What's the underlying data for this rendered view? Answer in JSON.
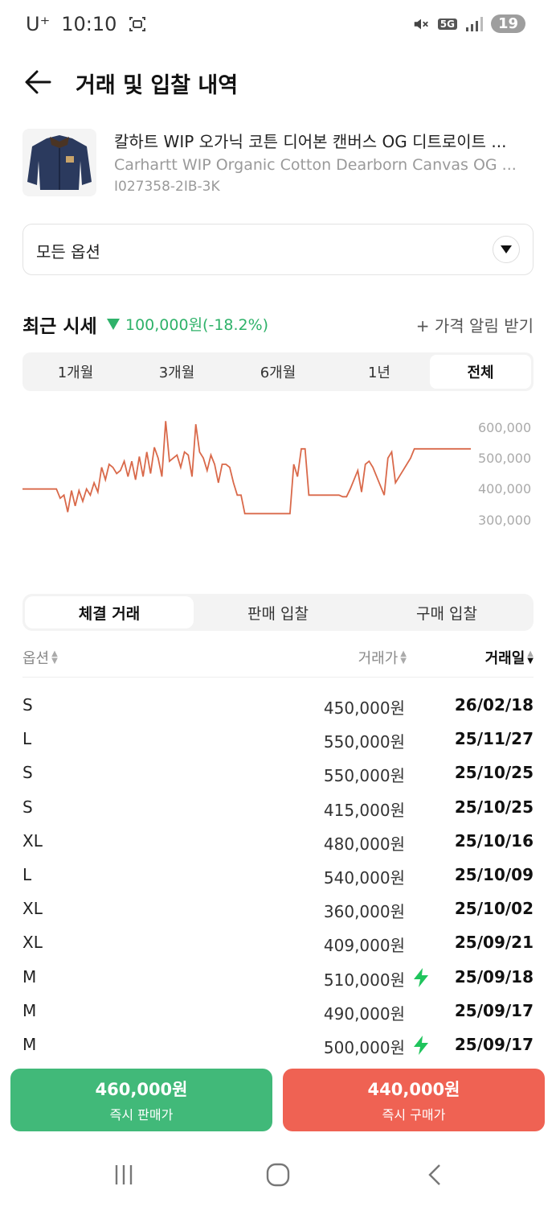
{
  "status_bar": {
    "carrier": "U⁺",
    "time": "10:10",
    "network": "5G",
    "battery": "19"
  },
  "header": {
    "title": "거래 및 입찰 내역"
  },
  "product": {
    "name_ko": "칼하트 WIP 오가닉 코튼 디어본 캔버스 OG 디트로이트 ...",
    "name_en": "Carhartt WIP Organic Cotton Dearborn Canvas OG ...",
    "code": "I027358-2IB-3K"
  },
  "option_select": {
    "value": "모든 옵션"
  },
  "recent_price": {
    "title": "최근 시세",
    "change": "100,000원(-18.2%)",
    "alert_label": "+ 가격 알림 받기"
  },
  "period_tabs": [
    {
      "label": "1개월",
      "active": false
    },
    {
      "label": "3개월",
      "active": false
    },
    {
      "label": "6개월",
      "active": false
    },
    {
      "label": "1년",
      "active": false
    },
    {
      "label": "전체",
      "active": true
    }
  ],
  "chart_data": {
    "type": "line",
    "y_ticks": [
      "600,000",
      "500,000",
      "400,000",
      "300,000"
    ],
    "ylim": [
      300000,
      600000
    ],
    "line_color": "#d9694a",
    "values": [
      400000,
      400000,
      400000,
      400000,
      400000,
      400000,
      400000,
      400000,
      400000,
      400000,
      370000,
      380000,
      325000,
      395000,
      345000,
      395000,
      360000,
      400000,
      380000,
      420000,
      390000,
      470000,
      430000,
      480000,
      470000,
      450000,
      460000,
      490000,
      440000,
      490000,
      430000,
      505000,
      440000,
      520000,
      450000,
      535000,
      500000,
      440000,
      620000,
      490000,
      500000,
      510000,
      470000,
      520000,
      510000,
      440000,
      610000,
      520000,
      500000,
      460000,
      510000,
      480000,
      420000,
      480000,
      480000,
      470000,
      420000,
      380000,
      380000,
      320000,
      320000,
      320000,
      320000,
      320000,
      320000,
      320000,
      320000,
      320000,
      320000,
      320000,
      320000,
      320000,
      480000,
      440000,
      530000,
      530000,
      380000,
      380000,
      380000,
      380000,
      380000,
      380000,
      380000,
      380000,
      380000,
      375000,
      375000,
      400000,
      430000,
      460000,
      390000,
      480000,
      490000,
      470000,
      440000,
      410000,
      380000,
      500000,
      520000,
      420000,
      440000,
      460000,
      480000,
      500000,
      530000,
      530000,
      530000,
      530000,
      530000,
      530000,
      530000,
      530000,
      530000,
      530000,
      530000,
      530000,
      530000,
      530000,
      530000,
      530000
    ]
  },
  "trade_tabs": [
    {
      "label": "체결 거래",
      "active": true
    },
    {
      "label": "판매 입찰",
      "active": false
    },
    {
      "label": "구매 입찰",
      "active": false
    }
  ],
  "table": {
    "headers": {
      "option": "옵션",
      "price": "거래가",
      "date": "거래일"
    },
    "rows": [
      {
        "option": "S",
        "price": "450,000원",
        "date": "26/02/18",
        "quick": false
      },
      {
        "option": "L",
        "price": "550,000원",
        "date": "25/11/27",
        "quick": false
      },
      {
        "option": "S",
        "price": "550,000원",
        "date": "25/10/25",
        "quick": false
      },
      {
        "option": "S",
        "price": "415,000원",
        "date": "25/10/25",
        "quick": false
      },
      {
        "option": "XL",
        "price": "480,000원",
        "date": "25/10/16",
        "quick": false
      },
      {
        "option": "L",
        "price": "540,000원",
        "date": "25/10/09",
        "quick": false
      },
      {
        "option": "XL",
        "price": "360,000원",
        "date": "25/10/02",
        "quick": false
      },
      {
        "option": "XL",
        "price": "409,000원",
        "date": "25/09/21",
        "quick": false
      },
      {
        "option": "M",
        "price": "510,000원",
        "date": "25/09/18",
        "quick": true
      },
      {
        "option": "M",
        "price": "490,000원",
        "date": "25/09/17",
        "quick": false
      },
      {
        "option": "M",
        "price": "500,000원",
        "date": "25/09/17",
        "quick": true
      }
    ]
  },
  "buttons": {
    "sell": {
      "price": "460,000원",
      "label": "즉시 판매가",
      "color": "#41b979"
    },
    "buy": {
      "price": "440,000원",
      "label": "즉시 구매가",
      "color": "#ef6253"
    }
  }
}
